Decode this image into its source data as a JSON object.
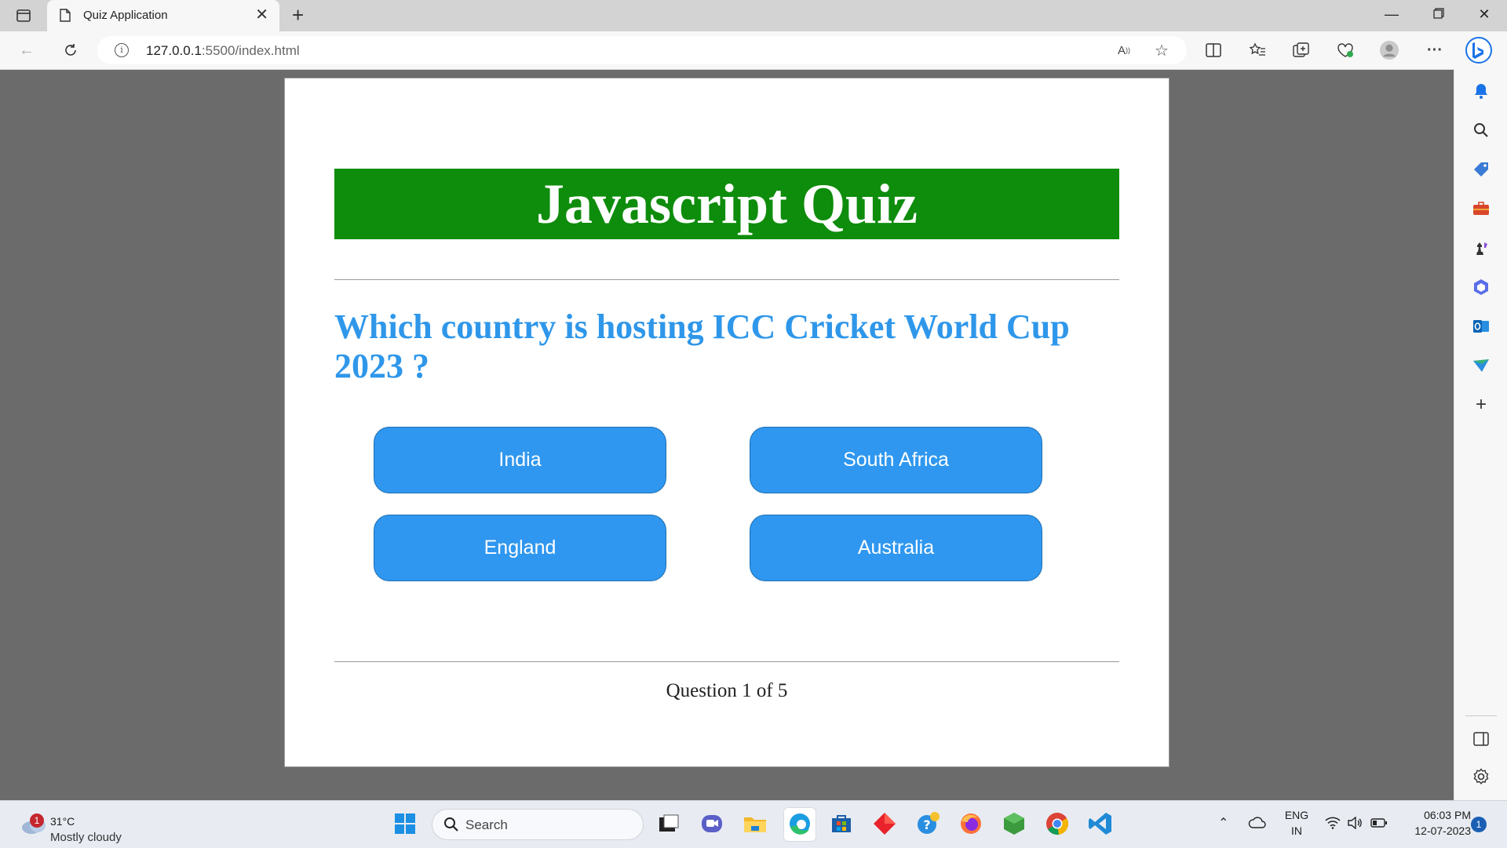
{
  "browser": {
    "tab_title": "Quiz Application",
    "url_host": "127.0.0.1",
    "url_rest": ":5500/index.html"
  },
  "quiz": {
    "title": "Javascript Quiz",
    "question": "Which country is hosting ICC Cricket World Cup 2023 ?",
    "options": [
      "India",
      "South Africa",
      "England",
      "Australia"
    ],
    "progress": "Question 1 of 5"
  },
  "taskbar": {
    "weather_temp": "31°C",
    "weather_desc": "Mostly cloudy",
    "weather_badge": "1",
    "search_placeholder": "Search",
    "lang_primary": "ENG",
    "lang_secondary": "IN",
    "time": "06:03 PM",
    "date": "12-07-2023",
    "notification_count": "1"
  },
  "colors": {
    "header_green": "#0e8c0c",
    "question_blue": "#2f97ea",
    "button_blue": "#2f97ef"
  }
}
